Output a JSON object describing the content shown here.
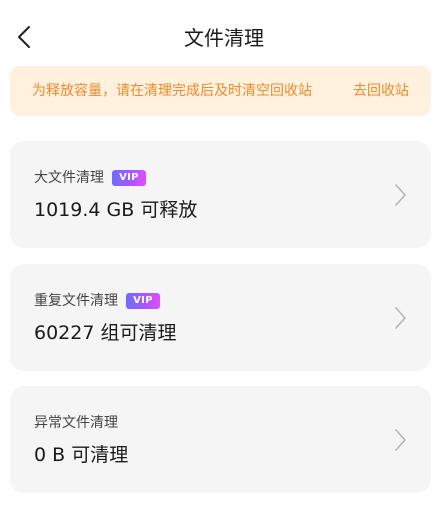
{
  "header": {
    "title": "文件清理",
    "back_icon": "chevron-left-icon"
  },
  "notice": {
    "text": "为释放容量，请在清理完成后及时清空回收站",
    "link": "去回收站",
    "color": "#f08a2a",
    "background": "#fff1de"
  },
  "cards": [
    {
      "label": "大文件清理",
      "badge": "VIP",
      "value": "1019.4 GB 可释放",
      "icon": "chevron-right-icon"
    },
    {
      "label": "重复文件清理",
      "badge": "VIP",
      "value": "60227 组可清理",
      "icon": "chevron-right-icon"
    },
    {
      "label": "异常文件清理",
      "value": "0 B 可清理",
      "icon": "chevron-right-icon"
    }
  ]
}
